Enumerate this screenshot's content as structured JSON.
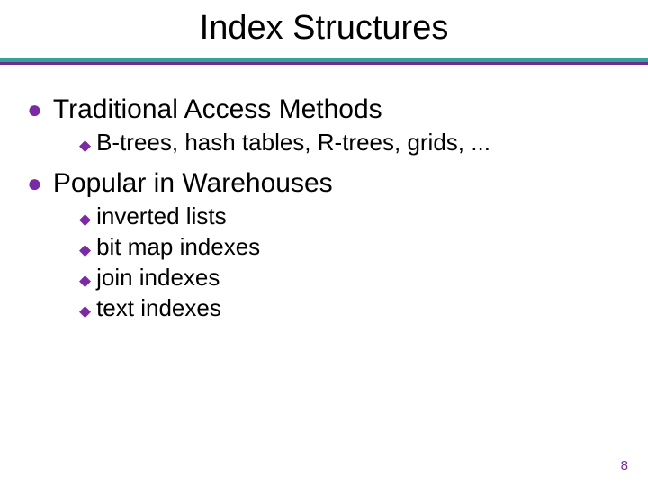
{
  "title": "Index Structures",
  "sections": [
    {
      "heading": "Traditional Access Methods",
      "items": [
        "B-trees, hash tables, R-trees, grids, ..."
      ]
    },
    {
      "heading": "Popular in Warehouses",
      "items": [
        "inverted lists",
        "bit map indexes",
        "join indexes",
        "text indexes"
      ]
    }
  ],
  "page_number": "8",
  "colors": {
    "accent": "#7a2aa3",
    "divider_top": "#36a39a",
    "divider_bottom": "#6b2f8f"
  }
}
